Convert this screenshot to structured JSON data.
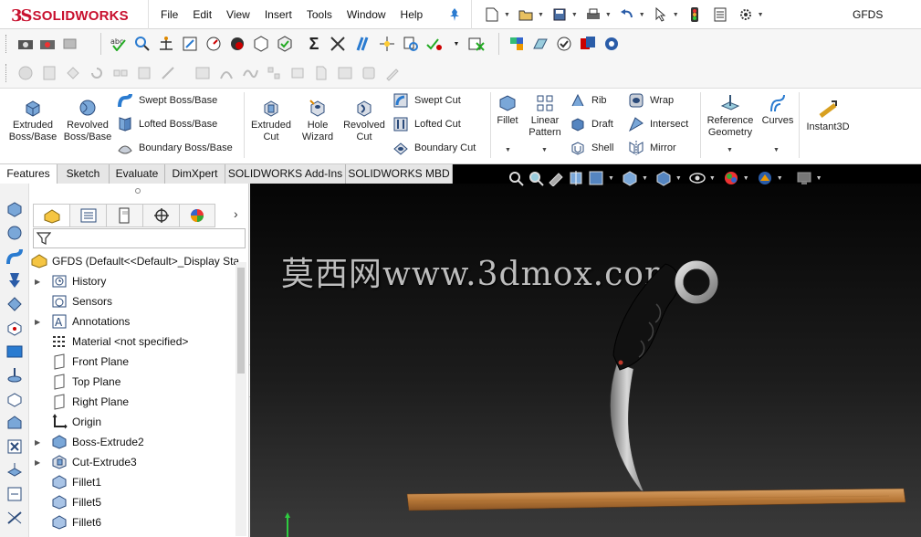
{
  "app": {
    "name": "SOLIDWORKS",
    "document_title": "GFDS"
  },
  "menu": [
    "File",
    "Edit",
    "View",
    "Insert",
    "Tools",
    "Window",
    "Help"
  ],
  "command_manager": {
    "extruded_boss": "Extruded\nBoss/Base",
    "revolved_boss": "Revolved\nBoss/Base",
    "swept_boss": "Swept Boss/Base",
    "lofted_boss": "Lofted Boss/Base",
    "boundary_boss": "Boundary Boss/Base",
    "extruded_cut": "Extruded\nCut",
    "hole_wizard": "Hole\nWizard",
    "revolved_cut": "Revolved\nCut",
    "swept_cut": "Swept Cut",
    "lofted_cut": "Lofted Cut",
    "boundary_cut": "Boundary Cut",
    "fillet": "Fillet",
    "linear_pattern": "Linear\nPattern",
    "rib": "Rib",
    "draft": "Draft",
    "shell": "Shell",
    "wrap": "Wrap",
    "intersect": "Intersect",
    "mirror": "Mirror",
    "reference_geometry": "Reference\nGeometry",
    "curves": "Curves",
    "instant3d": "Instant3D"
  },
  "tabs": [
    "Features",
    "Sketch",
    "Evaluate",
    "DimXpert",
    "SOLIDWORKS Add-Ins",
    "SOLIDWORKS MBD"
  ],
  "active_tab": "Features",
  "feature_tree": {
    "root": "GFDS  (Default<<Default>_Display Sta",
    "items": [
      {
        "label": "History",
        "icon": "history-icon",
        "expandable": true
      },
      {
        "label": "Sensors",
        "icon": "sensors-icon",
        "expandable": false
      },
      {
        "label": "Annotations",
        "icon": "annotations-icon",
        "expandable": true
      },
      {
        "label": "Material <not specified>",
        "icon": "material-icon",
        "expandable": false
      },
      {
        "label": "Front Plane",
        "icon": "plane-icon",
        "expandable": false
      },
      {
        "label": "Top Plane",
        "icon": "plane-icon",
        "expandable": false
      },
      {
        "label": "Right Plane",
        "icon": "plane-icon",
        "expandable": false
      },
      {
        "label": "Origin",
        "icon": "origin-icon",
        "expandable": false
      },
      {
        "label": "Boss-Extrude2",
        "icon": "boss-extrude-icon",
        "expandable": true
      },
      {
        "label": "Cut-Extrude3",
        "icon": "cut-extrude-icon",
        "expandable": true
      },
      {
        "label": "Fillet1",
        "icon": "fillet-icon",
        "expandable": false
      },
      {
        "label": "Fillet5",
        "icon": "fillet-icon",
        "expandable": false
      },
      {
        "label": "Fillet6",
        "icon": "fillet-icon",
        "expandable": false
      }
    ]
  },
  "viewport": {
    "watermark": "莫西网www.3dmox.com"
  },
  "colors": {
    "brand": "#c8102e",
    "accent": "#2a7bd0",
    "viewport_top": "#050505",
    "viewport_bottom": "#3a3a3a"
  }
}
